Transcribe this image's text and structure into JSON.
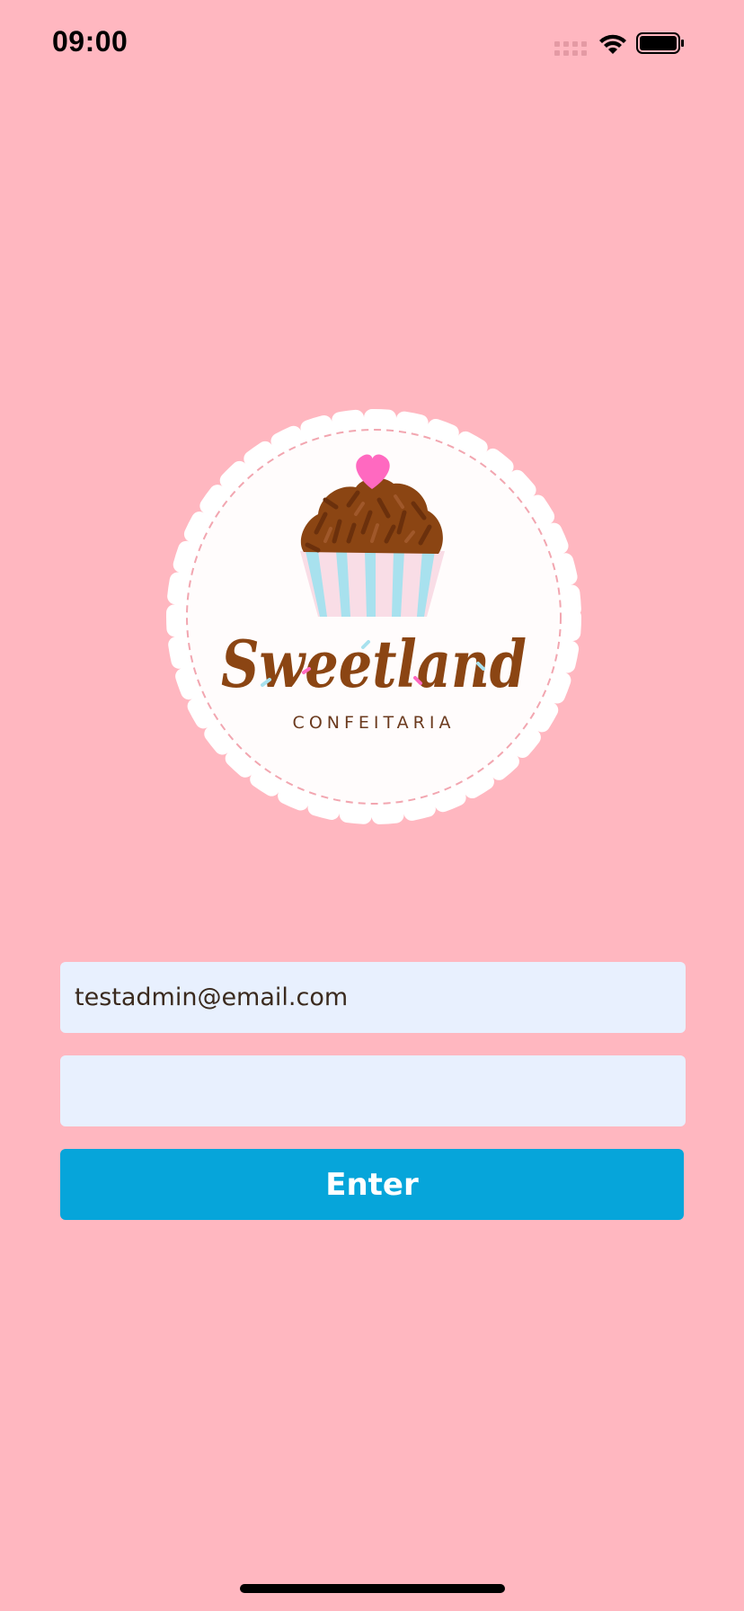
{
  "status_bar": {
    "time": "09:00"
  },
  "logo": {
    "brand_name": "Sweetland",
    "tagline": "CONFEITARIA",
    "icon": "cupcake-icon"
  },
  "login_form": {
    "email_value": "testadmin@email.com",
    "password_value": "",
    "enter_label": "Enter"
  },
  "colors": {
    "background": "#FFB7C0",
    "input_background": "#E8F0FE",
    "button": "#06A5DA",
    "brand_brown": "#8B4513"
  }
}
